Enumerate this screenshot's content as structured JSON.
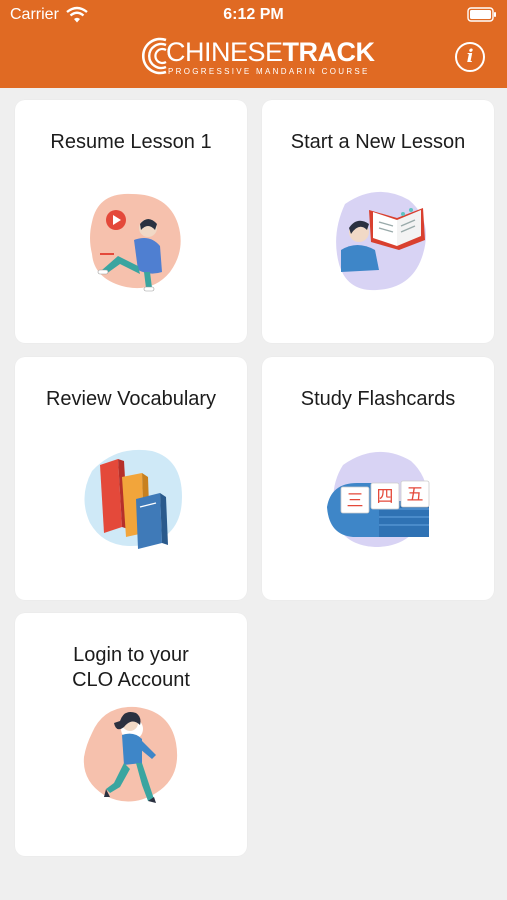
{
  "status_bar": {
    "carrier": "Carrier",
    "time": "6:12 PM"
  },
  "header": {
    "logo_word_thin": "CHINESE",
    "logo_word_bold": "TRACK",
    "logo_subtitle": "PROGRESSIVE MANDARIN COURSE",
    "info_label": "i",
    "accent_color": "#e06a23"
  },
  "cards": {
    "resume": {
      "title": "Resume Lesson 1",
      "icon": "video-lesson-illustration"
    },
    "new_lesson": {
      "title": "Start a New Lesson",
      "icon": "open-book-illustration"
    },
    "vocabulary": {
      "title": "Review Vocabulary",
      "icon": "books-illustration"
    },
    "flashcards": {
      "title": "Study Flashcards",
      "icon": "flashcards-illustration",
      "characters": [
        "三",
        "四",
        "五"
      ]
    },
    "login": {
      "title_line1": "Login to your",
      "title_line2": "CLO Account",
      "icon": "walking-person-illustration"
    }
  }
}
